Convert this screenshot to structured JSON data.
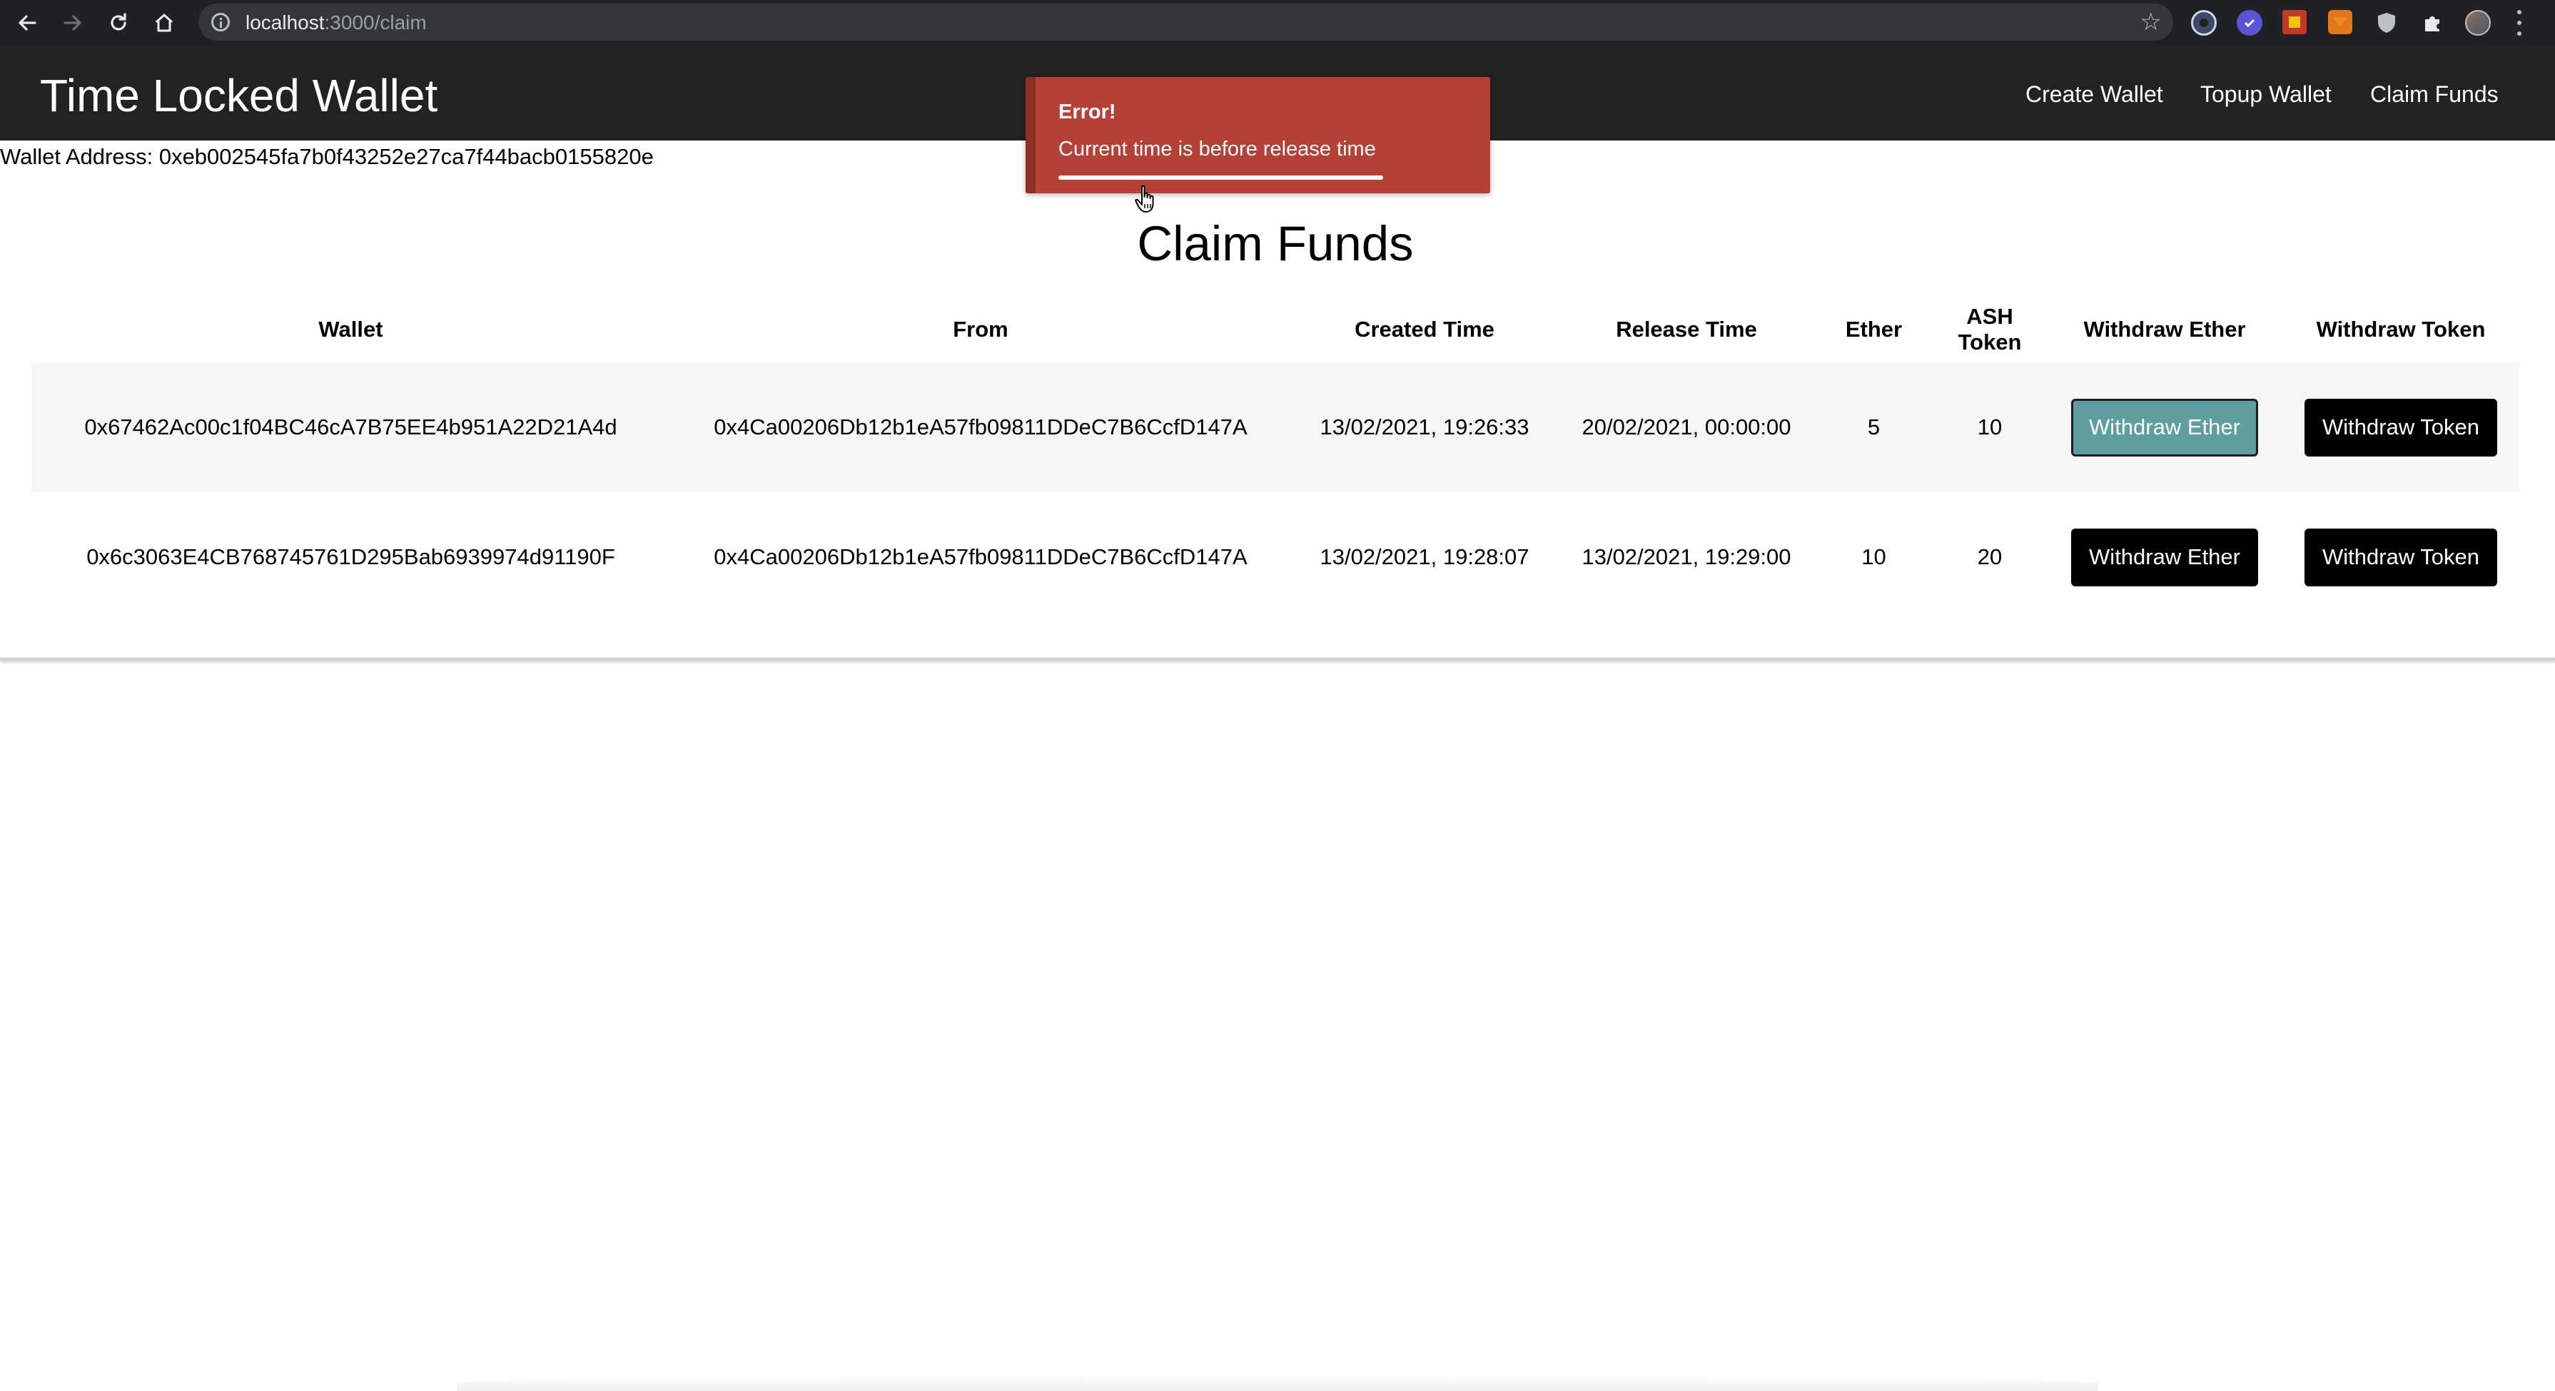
{
  "browser": {
    "url_host": "localhost",
    "url_path": ":3000/claim",
    "icons": {
      "back": "arrow-left-icon",
      "forward": "arrow-right-icon",
      "reload": "reload-icon",
      "home": "home-icon",
      "site_info": "info-icon",
      "bookmark": "star-icon",
      "extensions": [
        "extension-1-icon",
        "extension-2-icon",
        "extension-3-icon",
        "metamask-fox-icon",
        "shield-icon",
        "puzzle-icon",
        "profile-avatar-icon"
      ],
      "menu": "kebab-menu-icon"
    }
  },
  "header": {
    "title": "Time Locked Wallet",
    "nav": [
      {
        "label": "Create Wallet"
      },
      {
        "label": "Topup Wallet"
      },
      {
        "label": "Claim Funds"
      }
    ]
  },
  "wallet_address_text": "Wallet Address: 0xeb002545fa7b0f43252e27ca7f44bacb0155820e",
  "page": {
    "heading": "Claim Funds"
  },
  "table": {
    "columns": [
      "Wallet",
      "From",
      "Created Time",
      "Release Time",
      "Ether",
      "ASH Token",
      "Withdraw Ether",
      "Withdraw Token"
    ],
    "rows": [
      {
        "wallet": "0x67462Ac00c1f04BC46cA7B75EE4b951A22D21A4d",
        "from": "0x4Ca00206Db12b1eA57fb09811DDeC7B6CcfD147A",
        "created": "13/02/2021, 19:26:33",
        "release": "20/02/2021, 00:00:00",
        "ether": "5",
        "token": "10",
        "withdraw_ether_label": "Withdraw Ether",
        "withdraw_token_label": "Withdraw Token"
      },
      {
        "wallet": "0x6c3063E4CB768745761D295Bab6939974d91190F",
        "from": "0x4Ca00206Db12b1eA57fb09811DDeC7B6CcfD147A",
        "created": "13/02/2021, 19:28:07",
        "release": "13/02/2021, 19:29:00",
        "ether": "10",
        "token": "20",
        "withdraw_ether_label": "Withdraw Ether",
        "withdraw_token_label": "Withdraw Token"
      }
    ]
  },
  "toast": {
    "title": "Error!",
    "message": "Current time is before release time",
    "color": "#b54136",
    "progress": 0.7
  },
  "colors": {
    "header_bg": "#222222",
    "button_bg": "#000000",
    "button_hover_bg": "#5f9ea0",
    "row_stripe": "#f6f6f6"
  }
}
